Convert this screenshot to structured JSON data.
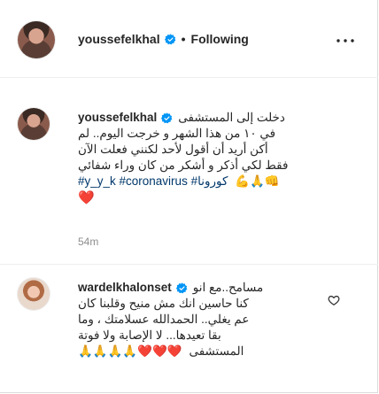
{
  "header": {
    "username": "youssefelkhal",
    "separator": "•",
    "follow_status": "Following",
    "more_icon": "more-horizontal-icon"
  },
  "caption": {
    "username": "youssefelkhal",
    "line1": "دخلت إلى المستشفى",
    "line2": "في ١٠ من هذا الشهر و خرجت اليوم.. لم",
    "line3": "أكن أريد أن أقول لأحد لكنني فعلت الآن",
    "line4": "فقط لكي أذكر و أشكر من كان وراء شفائي",
    "emojis_line5": "💪🙏👊",
    "hashtags": "#y_y_k #coronavirus #كورونا",
    "heart_line6": "❤️",
    "timestamp": "54m"
  },
  "reply": {
    "username": "wardelkhalonset",
    "line1": "مسامح..مع انو",
    "line2": "كنا حاسين انك مش منيح وقلبنا كان",
    "line3": "عم يغلي.. الحمدالله عسلامتك ، وما",
    "line4": "بقا تعيدها... لا الإصابة ولا فوتة",
    "line5_text": "المستشفى",
    "line5_emojis": "🙏🙏🙏🙏❤️❤️❤️",
    "like_icon": "heart-outline-icon"
  },
  "colors": {
    "text": "#262626",
    "muted": "#8e8e8e",
    "link": "#00376b",
    "verified": "#0095f6",
    "heart": "#ed1c24"
  }
}
